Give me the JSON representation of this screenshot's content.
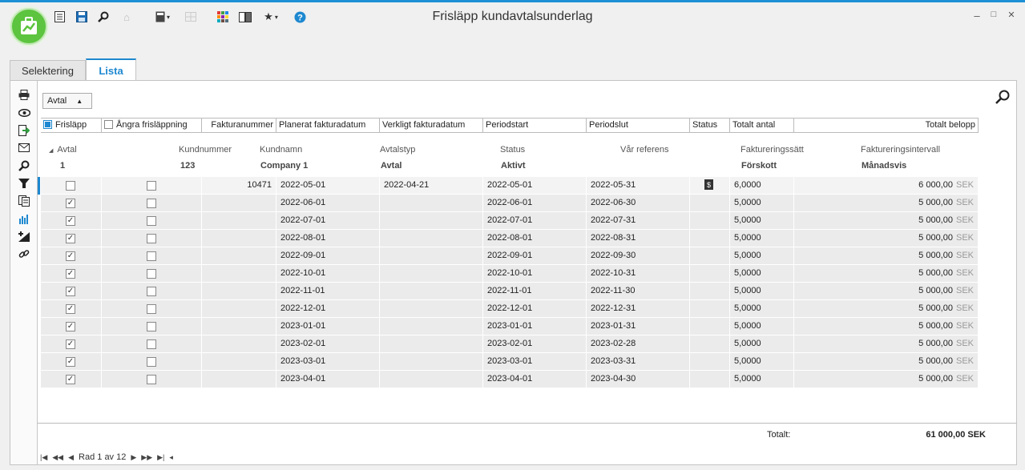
{
  "window": {
    "title": "Frisläpp kundavtalsunderlag",
    "minimize": "–",
    "maximize": "□",
    "close": "✕"
  },
  "tabs": [
    {
      "label": "Selektering"
    },
    {
      "label": "Lista"
    }
  ],
  "group_dropdown": {
    "value": "Avtal"
  },
  "columns": {
    "release": "Frisläpp",
    "undo": "Ångra frisläppning",
    "invoice_no": "Fakturanummer",
    "planned_date": "Planerat fakturadatum",
    "actual_date": "Verkligt fakturadatum",
    "period_start": "Periodstart",
    "period_end": "Periodslut",
    "status": "Status",
    "total_qty": "Totalt antal",
    "total_amount": "Totalt belopp"
  },
  "group": {
    "captions": {
      "avtal": "Avtal",
      "kundnummer": "Kundnummer",
      "kundnamn": "Kundnamn",
      "avtalstyp": "Avtalstyp",
      "status": "Status",
      "var_referens": "Vår referens",
      "faktureringssatt": "Faktureringssätt",
      "faktureringsintervall": "Faktureringsintervall"
    },
    "values": {
      "avtal": "1",
      "kundnummer": "123",
      "kundnamn": "Company 1",
      "avtalstyp": "Avtal",
      "status": "Aktivt",
      "var_referens": "",
      "faktureringssatt": "Förskott",
      "faktureringsintervall": "Månadsvis"
    }
  },
  "rows": [
    {
      "release": false,
      "undo": false,
      "invoice_no": "10471",
      "planned": "2022-05-01",
      "actual": "2022-04-21",
      "start": "2022-05-01",
      "end": "2022-05-31",
      "status_icon": "invoice-icon",
      "qty": "6,0000",
      "amount": "6 000,00",
      "currency": "SEK"
    },
    {
      "release": true,
      "undo": false,
      "invoice_no": "",
      "planned": "2022-06-01",
      "actual": "",
      "start": "2022-06-01",
      "end": "2022-06-30",
      "status_icon": "",
      "qty": "5,0000",
      "amount": "5 000,00",
      "currency": "SEK"
    },
    {
      "release": true,
      "undo": false,
      "invoice_no": "",
      "planned": "2022-07-01",
      "actual": "",
      "start": "2022-07-01",
      "end": "2022-07-31",
      "status_icon": "",
      "qty": "5,0000",
      "amount": "5 000,00",
      "currency": "SEK"
    },
    {
      "release": true,
      "undo": false,
      "invoice_no": "",
      "planned": "2022-08-01",
      "actual": "",
      "start": "2022-08-01",
      "end": "2022-08-31",
      "status_icon": "",
      "qty": "5,0000",
      "amount": "5 000,00",
      "currency": "SEK"
    },
    {
      "release": true,
      "undo": false,
      "invoice_no": "",
      "planned": "2022-09-01",
      "actual": "",
      "start": "2022-09-01",
      "end": "2022-09-30",
      "status_icon": "",
      "qty": "5,0000",
      "amount": "5 000,00",
      "currency": "SEK"
    },
    {
      "release": true,
      "undo": false,
      "invoice_no": "",
      "planned": "2022-10-01",
      "actual": "",
      "start": "2022-10-01",
      "end": "2022-10-31",
      "status_icon": "",
      "qty": "5,0000",
      "amount": "5 000,00",
      "currency": "SEK"
    },
    {
      "release": true,
      "undo": false,
      "invoice_no": "",
      "planned": "2022-11-01",
      "actual": "",
      "start": "2022-11-01",
      "end": "2022-11-30",
      "status_icon": "",
      "qty": "5,0000",
      "amount": "5 000,00",
      "currency": "SEK"
    },
    {
      "release": true,
      "undo": false,
      "invoice_no": "",
      "planned": "2022-12-01",
      "actual": "",
      "start": "2022-12-01",
      "end": "2022-12-31",
      "status_icon": "",
      "qty": "5,0000",
      "amount": "5 000,00",
      "currency": "SEK"
    },
    {
      "release": true,
      "undo": false,
      "invoice_no": "",
      "planned": "2023-01-01",
      "actual": "",
      "start": "2023-01-01",
      "end": "2023-01-31",
      "status_icon": "",
      "qty": "5,0000",
      "amount": "5 000,00",
      "currency": "SEK"
    },
    {
      "release": true,
      "undo": false,
      "invoice_no": "",
      "planned": "2023-02-01",
      "actual": "",
      "start": "2023-02-01",
      "end": "2023-02-28",
      "status_icon": "",
      "qty": "5,0000",
      "amount": "5 000,00",
      "currency": "SEK"
    },
    {
      "release": true,
      "undo": false,
      "invoice_no": "",
      "planned": "2023-03-01",
      "actual": "",
      "start": "2023-03-01",
      "end": "2023-03-31",
      "status_icon": "",
      "qty": "5,0000",
      "amount": "5 000,00",
      "currency": "SEK"
    },
    {
      "release": true,
      "undo": false,
      "invoice_no": "",
      "planned": "2023-04-01",
      "actual": "",
      "start": "2023-04-01",
      "end": "2023-04-30",
      "status_icon": "",
      "qty": "5,0000",
      "amount": "5 000,00",
      "currency": "SEK"
    }
  ],
  "footer": {
    "total_label": "Totalt:",
    "total_value": "61 000,00 SEK",
    "pager": "Rad 1 av 12"
  },
  "colors": {
    "accent": "#1e88d0",
    "logo": "#5cc43e",
    "row_bg": "#ebebeb"
  }
}
